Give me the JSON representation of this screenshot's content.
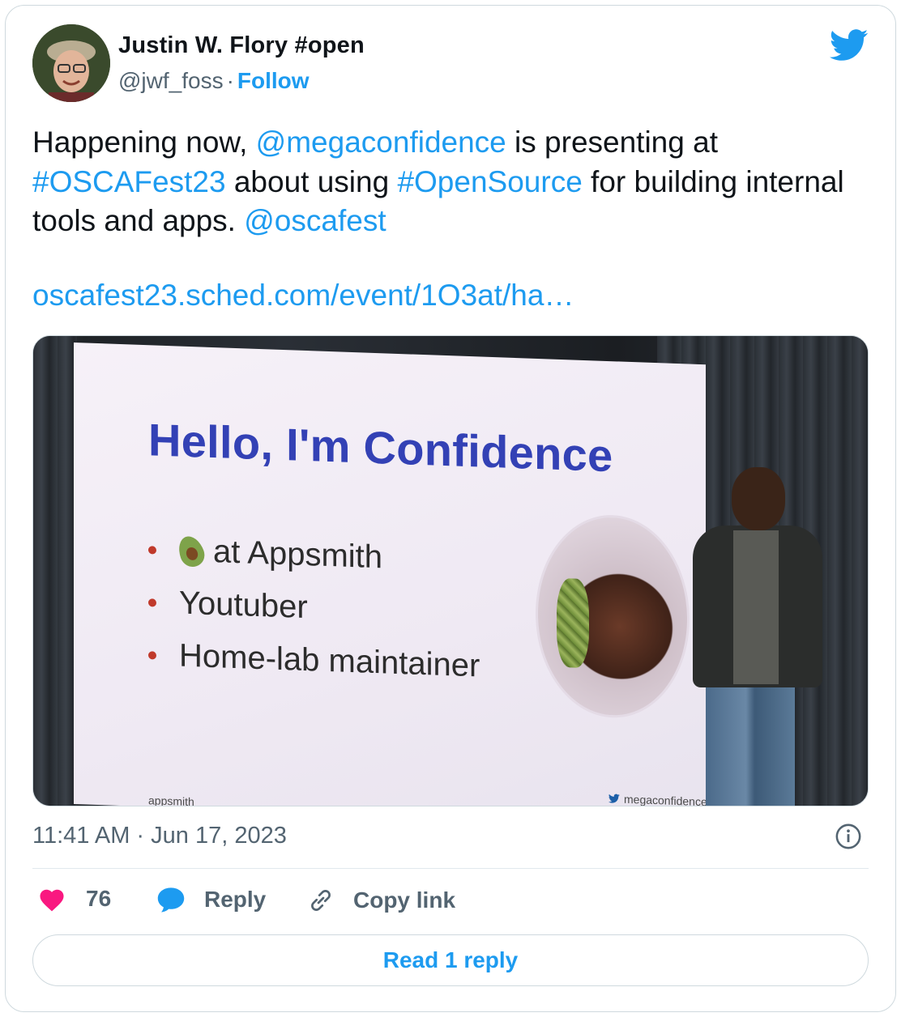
{
  "author": {
    "name": "Justin W. Flory #open",
    "handle": "@jwf_foss",
    "separator": "·",
    "follow_label": "Follow"
  },
  "tweet": {
    "segments": [
      {
        "text": "Happening now, ",
        "link": false
      },
      {
        "text": "@megaconfidence",
        "link": true
      },
      {
        "text": " is presenting at ",
        "link": false
      },
      {
        "text": "#OSCAFest23",
        "link": true
      },
      {
        "text": " about using ",
        "link": false
      },
      {
        "text": "#OpenSource",
        "link": true
      },
      {
        "text": " for building internal tools and apps. ",
        "link": false
      },
      {
        "text": "@oscafest",
        "link": true
      }
    ],
    "url": "oscafest23.sched.com/event/1O3at/ha…"
  },
  "photo": {
    "slide_title": "Hello, I'm Confidence",
    "bullets": [
      "at Appsmith",
      "Youtuber",
      "Home-lab maintainer"
    ],
    "slide_handle": "megaconfidence",
    "slide_brand": "appsmith_"
  },
  "meta": {
    "timestamp": "11:41 AM · Jun 17, 2023"
  },
  "actions": {
    "like_count": "76",
    "reply_label": "Reply",
    "copy_label": "Copy link",
    "read_replies_label": "Read 1 reply"
  },
  "colors": {
    "accent": "#1d9bf0",
    "like": "#f91880",
    "text": "#0f1419",
    "muted": "#536471",
    "slide_title": "#3341b5"
  },
  "icons": {
    "brand": "twitter-bird-icon",
    "info": "info-icon",
    "like": "heart-icon",
    "reply": "speech-bubble-icon",
    "copy": "link-icon"
  }
}
